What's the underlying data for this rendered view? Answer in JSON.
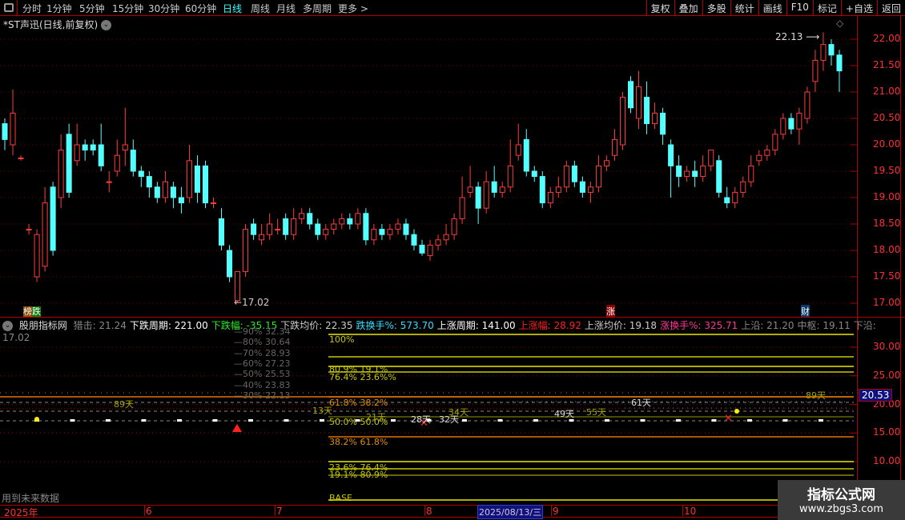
{
  "toolbar": {
    "periods": [
      "分时",
      "1分钟",
      "5分钟",
      "15分钟",
      "30分钟",
      "60分钟",
      "日线",
      "周线",
      "月线",
      "多周期",
      "更多 >"
    ],
    "active": "日线",
    "right_buttons": [
      "复权",
      "叠加",
      "多股",
      "统计",
      "画线",
      "F10",
      "标记",
      "+自选",
      "返回"
    ]
  },
  "main": {
    "title": "*ST声迅(日线,前复权)",
    "high_label": "22.13",
    "low_label": "17.02",
    "badges": {
      "bang": "榜",
      "die": "跌",
      "zhang": "涨",
      "cai": "财"
    }
  },
  "colors": {
    "up": "#ff3c3c",
    "down": "#54ffff",
    "axis": "#b00000",
    "axis_text": "#ff3030",
    "fib": "#c8c800",
    "orange": "#e07000"
  },
  "chart_data": {
    "type": "candlestick",
    "y_ticks": [
      "22.00",
      "21.50",
      "21.00",
      "20.50",
      "20.00",
      "19.50",
      "19.00",
      "18.50",
      "18.00",
      "17.50",
      "17.00"
    ],
    "ylim": [
      17.0,
      22.0
    ],
    "ohlc": [
      [
        20.4,
        20.5,
        19.9,
        20.1
      ],
      [
        20.0,
        21.05,
        19.8,
        20.6
      ],
      [
        19.75,
        19.8,
        19.7,
        19.75
      ],
      [
        18.4,
        18.5,
        18.3,
        18.4
      ],
      [
        17.5,
        18.4,
        17.4,
        18.3
      ],
      [
        17.7,
        19.2,
        17.6,
        18.9
      ],
      [
        19.2,
        19.3,
        17.9,
        18.0
      ],
      [
        19.0,
        20.2,
        18.8,
        19.9
      ],
      [
        20.2,
        20.4,
        19.0,
        19.1
      ],
      [
        19.7,
        20.4,
        19.6,
        20.0
      ],
      [
        20.0,
        20.1,
        19.7,
        19.9
      ],
      [
        20.0,
        20.1,
        19.8,
        19.9
      ],
      [
        20.0,
        20.4,
        19.5,
        19.6
      ],
      [
        19.3,
        19.5,
        19.1,
        19.3
      ],
      [
        19.5,
        20.1,
        19.4,
        19.8
      ],
      [
        19.9,
        20.7,
        19.6,
        20.0
      ],
      [
        19.9,
        20.1,
        19.4,
        19.5
      ],
      [
        19.5,
        19.6,
        19.2,
        19.4
      ],
      [
        19.4,
        19.5,
        19.0,
        19.2
      ],
      [
        19.2,
        19.3,
        18.9,
        19.0
      ],
      [
        19.0,
        19.5,
        18.9,
        19.3
      ],
      [
        19.2,
        19.3,
        18.8,
        19.0
      ],
      [
        19.0,
        19.2,
        18.7,
        18.9
      ],
      [
        19.0,
        20.0,
        18.9,
        19.7
      ],
      [
        19.6,
        19.8,
        18.9,
        19.1
      ],
      [
        19.6,
        19.7,
        18.8,
        18.9
      ],
      [
        18.9,
        19.0,
        18.8,
        18.9
      ],
      [
        18.6,
        18.8,
        18.0,
        18.1
      ],
      [
        18.0,
        18.1,
        17.4,
        17.5
      ],
      [
        17.05,
        17.6,
        17.02,
        17.6
      ],
      [
        17.6,
        18.5,
        17.5,
        18.4
      ],
      [
        18.5,
        18.6,
        18.2,
        18.3
      ],
      [
        18.2,
        18.5,
        18.1,
        18.3
      ],
      [
        18.3,
        18.7,
        18.2,
        18.5
      ],
      [
        18.4,
        18.6,
        18.3,
        18.4
      ],
      [
        18.6,
        18.7,
        18.2,
        18.3
      ],
      [
        18.3,
        18.8,
        18.2,
        18.6
      ],
      [
        18.6,
        18.8,
        18.5,
        18.7
      ],
      [
        18.7,
        18.8,
        18.4,
        18.5
      ],
      [
        18.5,
        18.6,
        18.2,
        18.3
      ],
      [
        18.3,
        18.5,
        18.2,
        18.4
      ],
      [
        18.4,
        18.6,
        18.3,
        18.5
      ],
      [
        18.5,
        18.7,
        18.4,
        18.6
      ],
      [
        18.6,
        18.7,
        18.4,
        18.5
      ],
      [
        18.5,
        18.8,
        18.4,
        18.7
      ],
      [
        18.7,
        18.8,
        18.1,
        18.2
      ],
      [
        18.2,
        18.5,
        18.1,
        18.4
      ],
      [
        18.4,
        18.5,
        18.2,
        18.3
      ],
      [
        18.3,
        18.5,
        18.2,
        18.4
      ],
      [
        18.4,
        18.6,
        18.3,
        18.5
      ],
      [
        18.5,
        18.6,
        18.2,
        18.3
      ],
      [
        18.3,
        18.4,
        18.0,
        18.1
      ],
      [
        18.1,
        18.2,
        17.9,
        17.95
      ],
      [
        17.9,
        18.2,
        17.8,
        18.1
      ],
      [
        18.1,
        18.3,
        18.0,
        18.2
      ],
      [
        18.2,
        18.5,
        18.1,
        18.3
      ],
      [
        18.3,
        18.7,
        18.2,
        18.6
      ],
      [
        18.6,
        19.4,
        18.5,
        19.0
      ],
      [
        19.1,
        19.6,
        19.0,
        19.2
      ],
      [
        19.2,
        19.3,
        18.5,
        18.8
      ],
      [
        18.8,
        19.5,
        18.7,
        19.3
      ],
      [
        19.3,
        19.6,
        19.0,
        19.1
      ],
      [
        19.1,
        19.3,
        19.0,
        19.2
      ],
      [
        19.2,
        20.1,
        19.1,
        19.6
      ],
      [
        19.8,
        20.4,
        19.7,
        20.0
      ],
      [
        20.1,
        20.3,
        19.4,
        19.5
      ],
      [
        19.5,
        19.6,
        19.3,
        19.4
      ],
      [
        19.4,
        19.5,
        18.8,
        18.9
      ],
      [
        18.9,
        19.2,
        18.8,
        19.1
      ],
      [
        19.1,
        19.4,
        19.0,
        19.2
      ],
      [
        19.2,
        19.7,
        19.1,
        19.6
      ],
      [
        19.6,
        19.7,
        19.2,
        19.3
      ],
      [
        19.3,
        19.4,
        19.0,
        19.1
      ],
      [
        19.1,
        19.3,
        18.9,
        19.2
      ],
      [
        19.2,
        19.8,
        19.1,
        19.6
      ],
      [
        19.6,
        19.8,
        19.5,
        19.7
      ],
      [
        19.8,
        20.3,
        19.7,
        20.1
      ],
      [
        20.0,
        21.0,
        19.9,
        20.9
      ],
      [
        21.2,
        21.3,
        20.6,
        20.7
      ],
      [
        20.5,
        21.4,
        20.3,
        21.1
      ],
      [
        20.9,
        21.2,
        20.2,
        20.4
      ],
      [
        20.4,
        20.8,
        20.3,
        20.6
      ],
      [
        20.6,
        20.7,
        20.0,
        20.2
      ],
      [
        20.0,
        20.1,
        19.0,
        19.6
      ],
      [
        19.6,
        19.8,
        19.2,
        19.4
      ],
      [
        19.4,
        19.6,
        19.3,
        19.5
      ],
      [
        19.5,
        19.7,
        19.2,
        19.4
      ],
      [
        19.4,
        19.8,
        19.3,
        19.6
      ],
      [
        19.6,
        19.9,
        19.5,
        19.9
      ],
      [
        19.7,
        19.8,
        19.0,
        19.1
      ],
      [
        19.0,
        19.2,
        18.8,
        18.9
      ],
      [
        18.9,
        19.2,
        18.8,
        19.1
      ],
      [
        19.1,
        19.4,
        19.0,
        19.3
      ],
      [
        19.3,
        19.8,
        19.2,
        19.6
      ],
      [
        19.7,
        19.9,
        19.6,
        19.8
      ],
      [
        19.8,
        20.0,
        19.7,
        19.9
      ],
      [
        19.9,
        20.3,
        19.8,
        20.2
      ],
      [
        20.2,
        20.6,
        20.1,
        20.5
      ],
      [
        20.5,
        20.6,
        20.2,
        20.3
      ],
      [
        20.3,
        20.7,
        20.0,
        20.6
      ],
      [
        20.5,
        21.1,
        20.4,
        21.0
      ],
      [
        21.2,
        21.8,
        21.0,
        21.6
      ],
      [
        21.6,
        22.13,
        21.4,
        21.9
      ],
      [
        21.9,
        22.0,
        21.5,
        21.7
      ],
      [
        21.7,
        21.8,
        21.0,
        21.4
      ]
    ]
  },
  "indicator": {
    "name": "股朋指标网",
    "items": [
      {
        "label": "猎击:",
        "value": "21.24",
        "color": "#888"
      },
      {
        "label": "下跌周期:",
        "value": "221.00",
        "color": "#fff"
      },
      {
        "label": "下跌幅:",
        "value": "-35.15",
        "color": "#22ee22"
      },
      {
        "label": "下跌均价:",
        "value": "22.35",
        "color": "#ccc"
      },
      {
        "label": "跌换手%:",
        "value": "573.70",
        "color": "#33ddff"
      },
      {
        "label": "上涨周期:",
        "value": "141.00",
        "color": "#fff"
      },
      {
        "label": "上涨幅:",
        "value": "28.92",
        "color": "#ff2020"
      },
      {
        "label": "上涨均价:",
        "value": "19.18",
        "color": "#ccc"
      },
      {
        "label": "涨换手%:",
        "value": "325.71",
        "color": "#ff3399"
      },
      {
        "label": "上沿:",
        "value": "21.20",
        "color": "#888"
      },
      {
        "label": "中枢:",
        "value": "19.11",
        "color": "#888"
      },
      {
        "label": "下沿:",
        "value": "17.02",
        "color": "#888"
      }
    ],
    "y_ticks": [
      "30.00",
      "25.00",
      "20.00",
      "15.00",
      "10.00"
    ],
    "current_value": "20.53",
    "pct_scale": [
      "—90%  32.34",
      "—80%  30.64",
      "—70%  28.93",
      "—60%  27.23",
      "—50%  25.53",
      "—40%  23.83",
      "—30%  22.13"
    ],
    "fib_labels": [
      "100%",
      "80.9%   19.1%",
      "76.4%   23.6%%",
      "61.8%   38.2%",
      "50.0%   50.0%",
      "38.2%   61.8%",
      "23.6%   76.4%",
      "19.1%   80.9%",
      "BASE"
    ],
    "days": [
      "89天",
      "13天",
      "21天",
      "28天",
      "32天",
      "34天",
      "49天",
      "55天",
      "61天",
      "89天"
    ],
    "footnote": "用到未来数据"
  },
  "time_axis": {
    "labels": [
      "2025年",
      "6",
      "7",
      "8",
      "9",
      "10"
    ],
    "cursor_date": "2025/08/13/三"
  },
  "watermark": {
    "title": "指标公式网",
    "url": "www.zbgs3.com"
  }
}
